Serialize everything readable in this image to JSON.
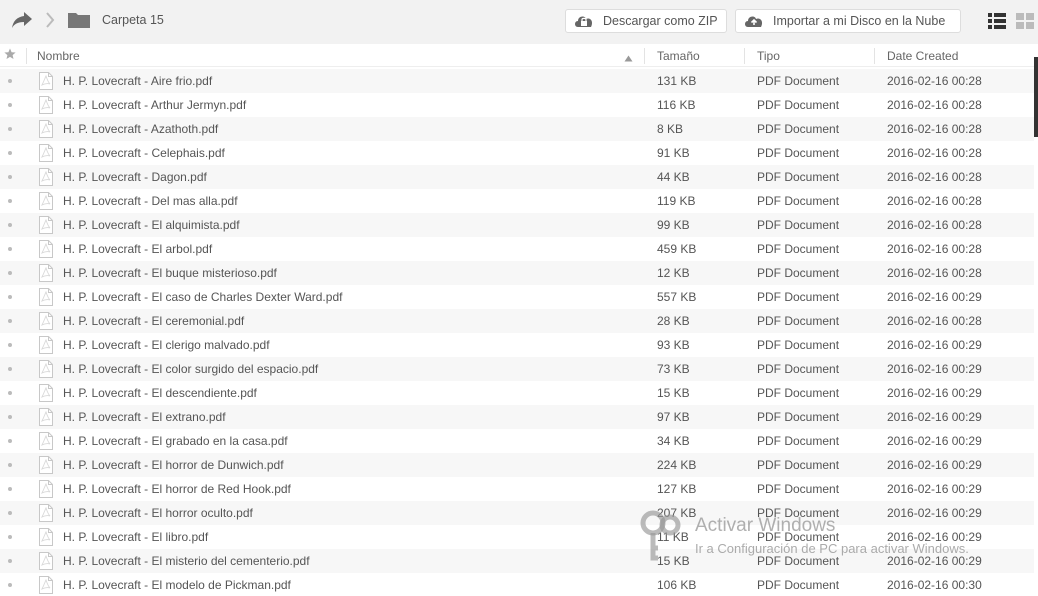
{
  "toolbar": {
    "breadcrumb": "Carpeta 15",
    "download_zip_label": "Descargar como ZIP",
    "import_label": "Importar a mi Disco en la Nube"
  },
  "columns": {
    "name": "Nombre",
    "size": "Tamaño",
    "type": "Tipo",
    "date": "Date Created"
  },
  "files": [
    {
      "name": "H. P. Lovecraft - Aire frio.pdf",
      "size": "131 KB",
      "type": "PDF Document",
      "date": "2016-02-16 00:28"
    },
    {
      "name": "H. P. Lovecraft - Arthur Jermyn.pdf",
      "size": "116 KB",
      "type": "PDF Document",
      "date": "2016-02-16 00:28"
    },
    {
      "name": "H. P. Lovecraft - Azathoth.pdf",
      "size": "8 KB",
      "type": "PDF Document",
      "date": "2016-02-16 00:28"
    },
    {
      "name": "H. P. Lovecraft - Celephais.pdf",
      "size": "91 KB",
      "type": "PDF Document",
      "date": "2016-02-16 00:28"
    },
    {
      "name": "H. P. Lovecraft - Dagon.pdf",
      "size": "44 KB",
      "type": "PDF Document",
      "date": "2016-02-16 00:28"
    },
    {
      "name": "H. P. Lovecraft - Del mas alla.pdf",
      "size": "119 KB",
      "type": "PDF Document",
      "date": "2016-02-16 00:28"
    },
    {
      "name": "H. P. Lovecraft - El alquimista.pdf",
      "size": "99 KB",
      "type": "PDF Document",
      "date": "2016-02-16 00:28"
    },
    {
      "name": "H. P. Lovecraft - El arbol.pdf",
      "size": "459 KB",
      "type": "PDF Document",
      "date": "2016-02-16 00:28"
    },
    {
      "name": "H. P. Lovecraft - El buque misterioso.pdf",
      "size": "12 KB",
      "type": "PDF Document",
      "date": "2016-02-16 00:28"
    },
    {
      "name": "H. P. Lovecraft - El caso de Charles Dexter Ward.pdf",
      "size": "557 KB",
      "type": "PDF Document",
      "date": "2016-02-16 00:29"
    },
    {
      "name": "H. P. Lovecraft - El ceremonial.pdf",
      "size": "28 KB",
      "type": "PDF Document",
      "date": "2016-02-16 00:28"
    },
    {
      "name": "H. P. Lovecraft - El clerigo malvado.pdf",
      "size": "93 KB",
      "type": "PDF Document",
      "date": "2016-02-16 00:29"
    },
    {
      "name": "H. P. Lovecraft - El color surgido del espacio.pdf",
      "size": "73 KB",
      "type": "PDF Document",
      "date": "2016-02-16 00:29"
    },
    {
      "name": "H. P. Lovecraft - El descendiente.pdf",
      "size": "15 KB",
      "type": "PDF Document",
      "date": "2016-02-16 00:29"
    },
    {
      "name": "H. P. Lovecraft - El extrano.pdf",
      "size": "97 KB",
      "type": "PDF Document",
      "date": "2016-02-16 00:29"
    },
    {
      "name": "H. P. Lovecraft - El grabado en la casa.pdf",
      "size": "34 KB",
      "type": "PDF Document",
      "date": "2016-02-16 00:29"
    },
    {
      "name": "H. P. Lovecraft - El horror de Dunwich.pdf",
      "size": "224 KB",
      "type": "PDF Document",
      "date": "2016-02-16 00:29"
    },
    {
      "name": "H. P. Lovecraft - El horror de Red Hook.pdf",
      "size": "127 KB",
      "type": "PDF Document",
      "date": "2016-02-16 00:29"
    },
    {
      "name": "H. P. Lovecraft - El horror oculto.pdf",
      "size": "207 KB",
      "type": "PDF Document",
      "date": "2016-02-16 00:29"
    },
    {
      "name": "H. P. Lovecraft - El libro.pdf",
      "size": "11 KB",
      "type": "PDF Document",
      "date": "2016-02-16 00:29"
    },
    {
      "name": "H. P. Lovecraft - El misterio del cementerio.pdf",
      "size": "15 KB",
      "type": "PDF Document",
      "date": "2016-02-16 00:29"
    },
    {
      "name": "H. P. Lovecraft - El modelo de Pickman.pdf",
      "size": "106 KB",
      "type": "PDF Document",
      "date": "2016-02-16 00:30"
    }
  ],
  "watermark": {
    "title": "Activar Windows",
    "subtitle": "Ir a Configuración de PC para activar Windows."
  },
  "icons": {
    "share": "share-icon",
    "back": "chevron-right-icon",
    "folder": "folder-icon",
    "zip": "cloud-lock-icon",
    "import": "cloud-upload-icon",
    "list_view": "list-view-icon",
    "grid_view": "grid-view-icon",
    "file": "pdf-file-icon"
  }
}
